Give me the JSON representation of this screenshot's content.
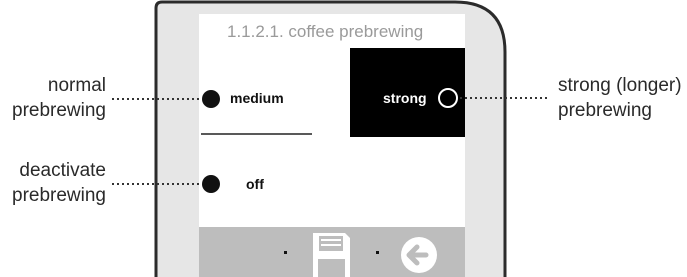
{
  "screen": {
    "title": "1.1.2.1.  coffee prebrewing",
    "options": [
      {
        "id": "medium",
        "label": "medium",
        "selected": false
      },
      {
        "id": "strong",
        "label": "strong",
        "selected": true
      },
      {
        "id": "off",
        "label": "off",
        "selected": false
      }
    ],
    "footer_icons": [
      "save-icon",
      "back-arrow-icon"
    ]
  },
  "callouts": {
    "normal": [
      "normal",
      "prebrewing"
    ],
    "deactivate": [
      "deactivate",
      "prebrewing"
    ],
    "strong": [
      "strong (longer)",
      "prebrewing"
    ]
  },
  "colors": {
    "device_fill": "#e6e6e6",
    "device_stroke": "#2b2b2b",
    "screen_bg": "#ffffff",
    "title_color": "#9a9a9a",
    "selected_bg": "#000000",
    "selected_text": "#ffffff",
    "footer_bg": "#bdbdbd",
    "icon_fill": "#ffffff"
  }
}
